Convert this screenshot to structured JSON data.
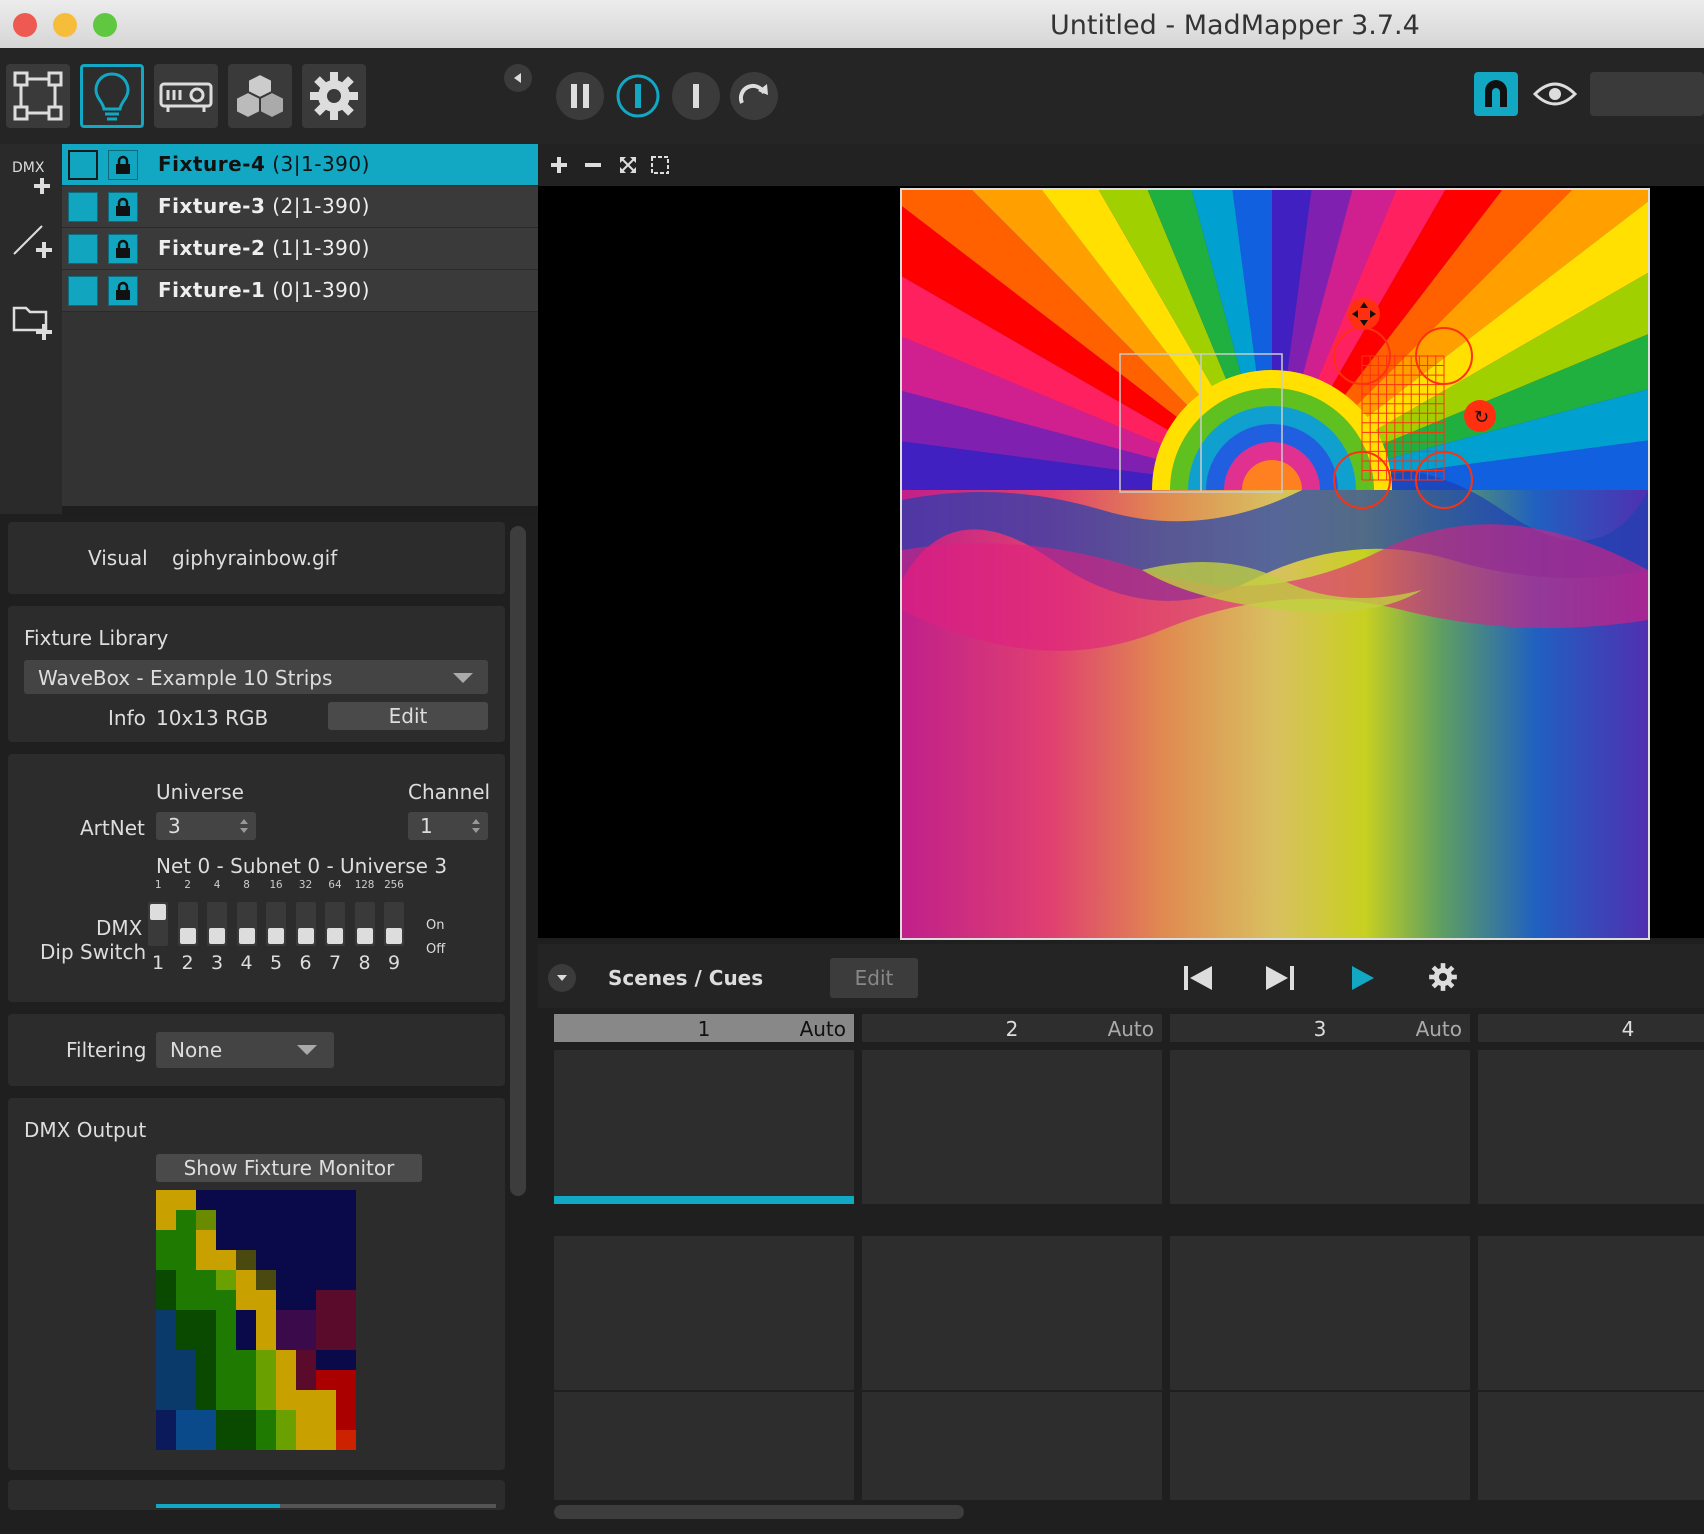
{
  "window": {
    "title": "Untitled - MadMapper 3.7.4"
  },
  "colors": {
    "accent": "#12a7c3",
    "close": "#ee5a52",
    "minimize": "#f6bd3b",
    "maximize": "#5fc840"
  },
  "toolbar": {
    "mode_buttons": [
      "surface-mode-icon",
      "fixture-mode-icon",
      "projector-icon",
      "cubes-icon",
      "gear-icon"
    ],
    "transport": [
      "pause-icon",
      "play-active-icon",
      "stop-icon",
      "loop-icon"
    ]
  },
  "sidebar": {
    "dmx_label": "DMX"
  },
  "fixtures": [
    {
      "name": "Fixture-4",
      "addr": " (3|1-390)",
      "selected": true
    },
    {
      "name": "Fixture-3",
      "addr": " (2|1-390)",
      "selected": false
    },
    {
      "name": "Fixture-2",
      "addr": " (1|1-390)",
      "selected": false
    },
    {
      "name": "Fixture-1",
      "addr": " (0|1-390)",
      "selected": false
    }
  ],
  "properties": {
    "visual_label": "Visual",
    "visual_value": "giphyrainbow.gif",
    "fixture_library_label": "Fixture Library",
    "fixture_library_value": "WaveBox - Example 10 Strips",
    "info_label": "Info",
    "info_value": "10x13 RGB",
    "edit_label": "Edit",
    "universe_label": "Universe",
    "channel_label": "Channel",
    "artnet_label": "ArtNet",
    "universe_value": "3",
    "channel_value": "1",
    "net_text": "Net 0 - Subnet 0 - Universe 3",
    "dmx_label": "DMX",
    "dip_label": "Dip Switch",
    "on_label": "On",
    "off_label": "Off",
    "dip_top": [
      "1",
      "2",
      "4",
      "8",
      "16",
      "32",
      "64",
      "128",
      "256"
    ],
    "dip_numbers": [
      "1",
      "2",
      "3",
      "4",
      "5",
      "6",
      "7",
      "8",
      "9"
    ],
    "dip_state": [
      true,
      false,
      false,
      false,
      false,
      false,
      false,
      false,
      false
    ],
    "filtering_label": "Filtering",
    "filtering_value": "None",
    "dmx_output_label": "DMX Output",
    "show_monitor_label": "Show Fixture Monitor"
  },
  "scenes": {
    "title": "Scenes / Cues",
    "edit_label": "Edit",
    "columns": [
      {
        "num": "1",
        "mode": "Auto",
        "active": true
      },
      {
        "num": "2",
        "mode": "Auto",
        "active": false
      },
      {
        "num": "3",
        "mode": "Auto",
        "active": false
      },
      {
        "num": "4",
        "mode": "",
        "active": false
      }
    ]
  }
}
